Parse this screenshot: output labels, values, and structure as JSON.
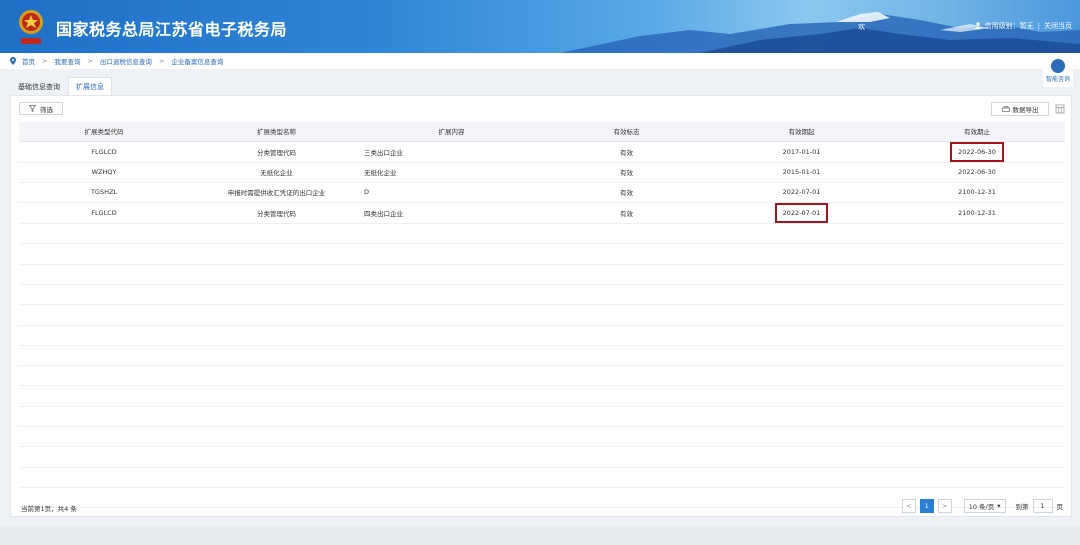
{
  "header": {
    "title": "国家税务总局江苏省电子税务局",
    "welcome": "欢",
    "credit_label": "信用级别：暂无",
    "close_label": "关闭当页",
    "separator": "|"
  },
  "breadcrumb": {
    "items": [
      "首页",
      "我要查询",
      "出口退税信息查询",
      "企业备案信息查询"
    ],
    "separator": ">"
  },
  "consult": {
    "label": "智能咨询"
  },
  "tabs": [
    {
      "label": "基础信息查询",
      "active": false
    },
    {
      "label": "扩展信息",
      "active": true
    }
  ],
  "toolbar": {
    "filter_label": "筛选",
    "export_label": "数据导出"
  },
  "table": {
    "headers": [
      "扩展类型代码",
      "扩展类型名称",
      "扩展内容",
      "有效标志",
      "有效期起",
      "有效期止"
    ],
    "rows": [
      [
        "FLGLCD",
        "分类管理代码",
        "三类出口企业",
        "有效",
        "2017-01-01",
        "2022-06-30"
      ],
      [
        "WZHQY",
        "无纸化企业",
        "无纸化企业",
        "有效",
        "2015-01-01",
        "2022-06-30"
      ],
      [
        "TGSHZL",
        "申报时需提供收汇凭证的出口企业",
        "D",
        "有效",
        "2022-07-01",
        "2100-12-31"
      ],
      [
        "FLGLCD",
        "分类管理代码",
        "四类出口企业",
        "有效",
        "2022-07-01",
        "2100-12-31"
      ]
    ],
    "empty_rows": 14
  },
  "footer": {
    "info": "当前第1页，共4 条",
    "current_page": "1",
    "page_size": "10 条/页",
    "goto_label": "到第",
    "goto_value": "1",
    "page_unit": "页",
    "prev": "<",
    "next": ">"
  },
  "colors": {
    "accent": "#2a7fd4",
    "highlight": "#a8141b",
    "header_bg": "#1f6fc6"
  }
}
